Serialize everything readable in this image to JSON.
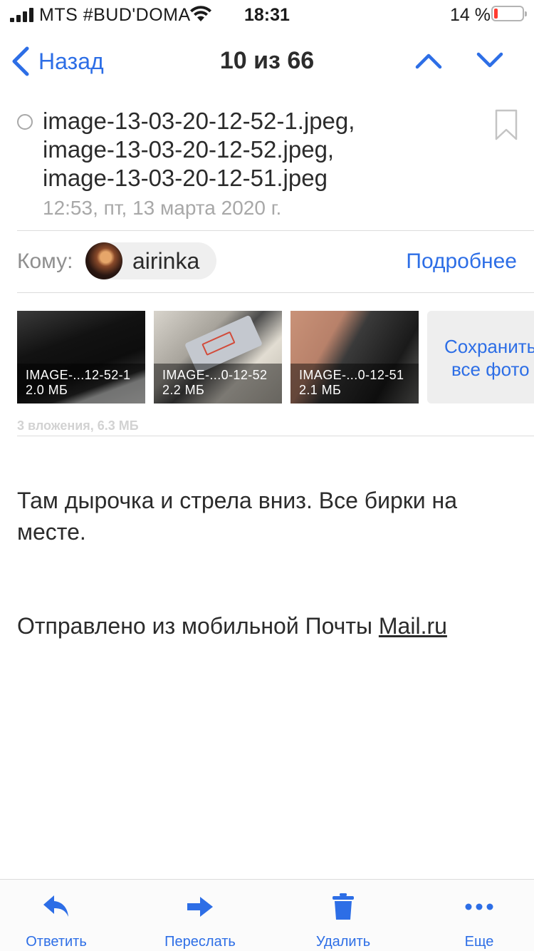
{
  "status_bar": {
    "carrier": "MTS #BUD'DOMA",
    "time": "18:31",
    "battery_percent": "14 %",
    "battery_level": 0.14,
    "battery_color": "#ff3b30"
  },
  "nav": {
    "back_label": "Назад",
    "title": "10 из 66",
    "icons": [
      "chevron-left-icon",
      "chevron-up-icon",
      "chevron-down-icon"
    ]
  },
  "message": {
    "subject_lines": [
      "image-13-03-20-12-52-1.jpeg,",
      "image-13-03-20-12-52.jpeg,",
      "image-13-03-20-12-51.jpeg"
    ],
    "datetime": "12:53, пт, 13 марта 2020 г.",
    "to_label": "Кому:",
    "recipient": "airinka",
    "details_label": "Подробнее"
  },
  "attachments": {
    "items": [
      {
        "name": "IMAGE-...12-52-1",
        "size": "2.0 МБ"
      },
      {
        "name": "IMAGE-...0-12-52",
        "size": "2.2 МБ"
      },
      {
        "name": "IMAGE-...0-12-51",
        "size": "2.1 МБ"
      }
    ],
    "save_all_line1": "Сохранить",
    "save_all_line2": "все фото",
    "summary": "3 вложения, 6.3 МБ"
  },
  "body": {
    "text": "Там дырочка и стрела вниз. Все бирки на месте.",
    "signature_prefix": "Отправлено из мобильной Почты ",
    "signature_link": "Mail.ru"
  },
  "toolbar": {
    "reply": "Ответить",
    "forward": "Переслать",
    "delete": "Удалить",
    "more": "Еще"
  },
  "colors": {
    "accent": "#2d6ee6",
    "secondary_text": "#a8a8a8"
  }
}
